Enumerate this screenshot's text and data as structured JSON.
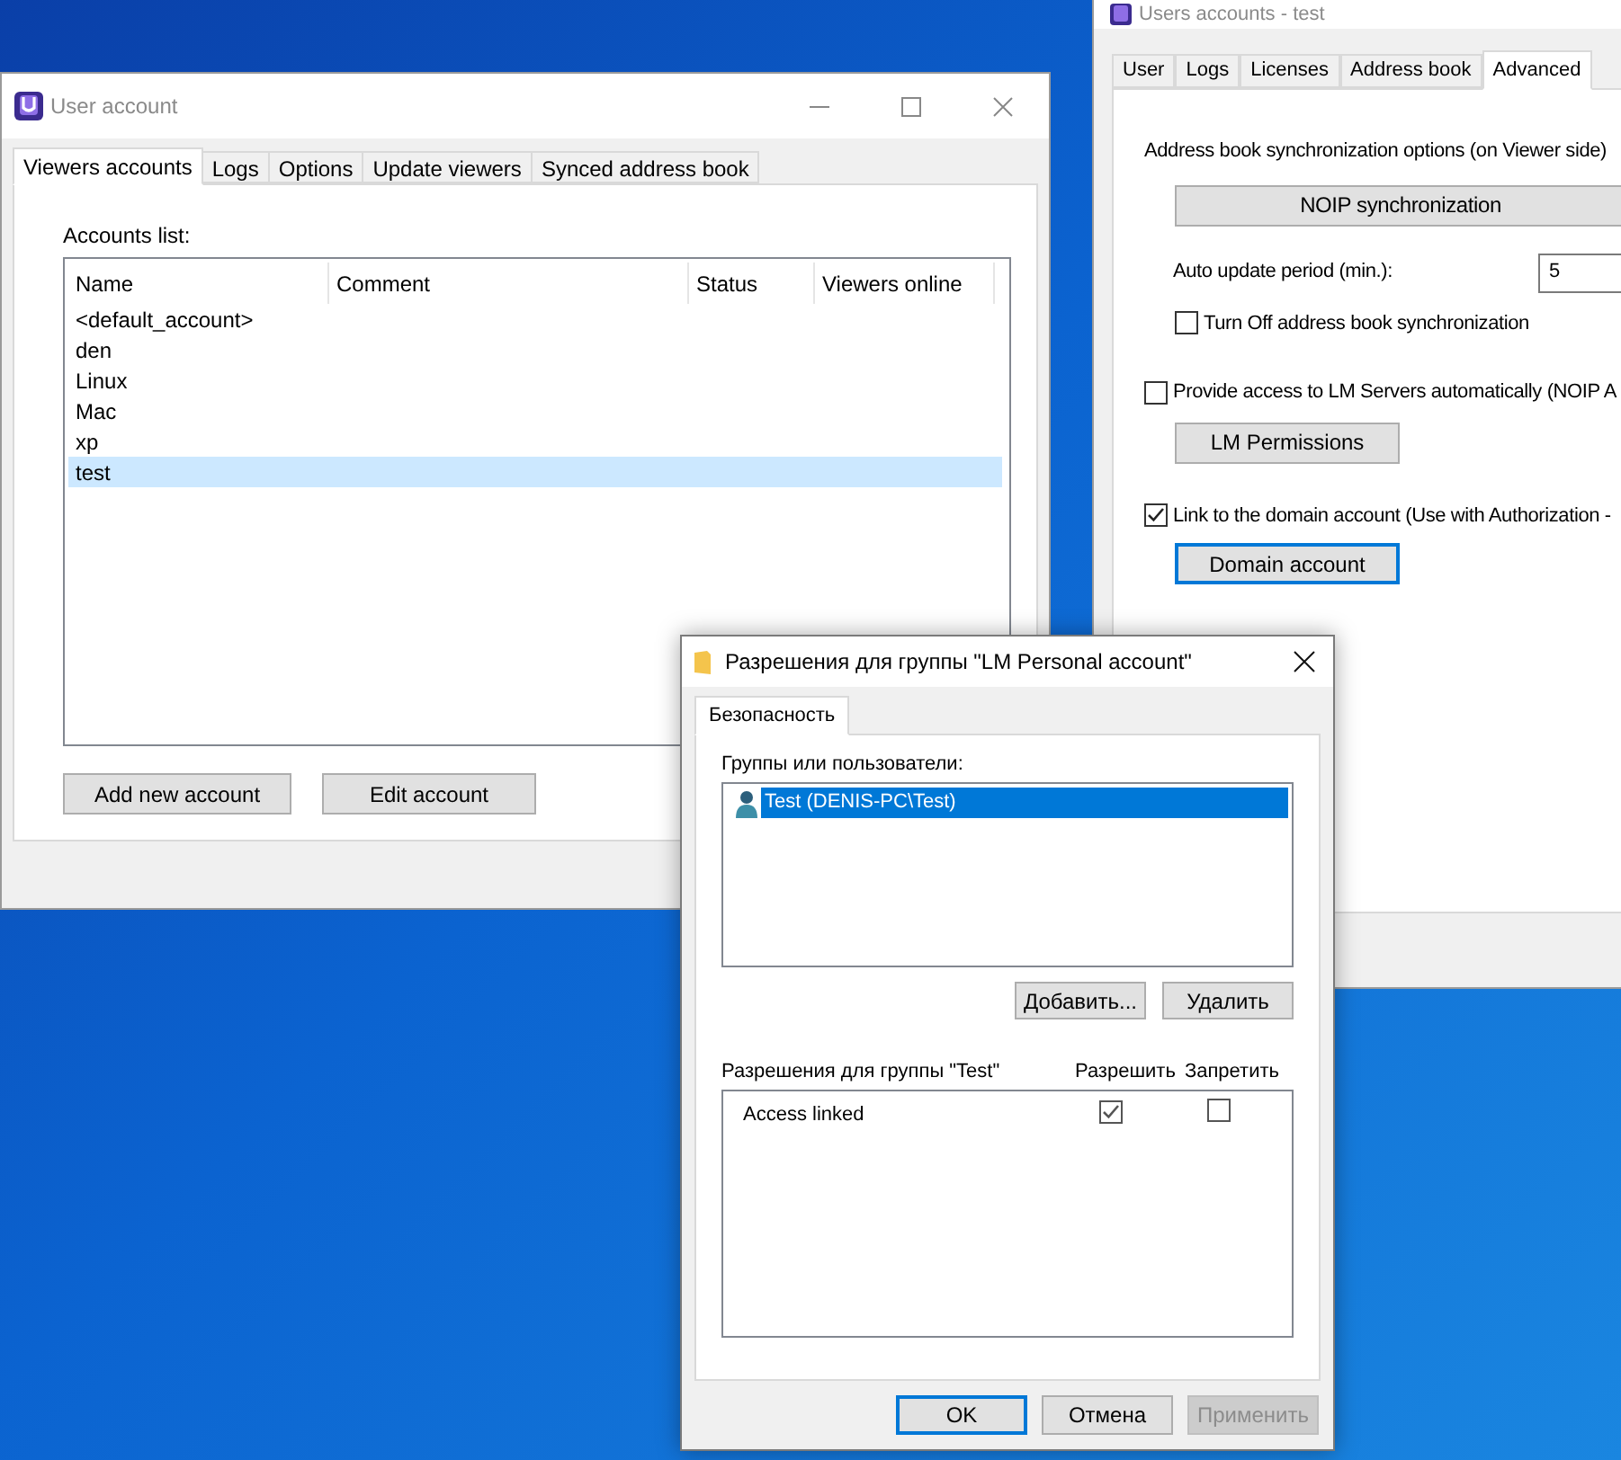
{
  "user_account_window": {
    "title": "User account",
    "tabs": [
      {
        "label": "Viewers accounts",
        "selected": true
      },
      {
        "label": "Logs",
        "selected": false
      },
      {
        "label": "Options",
        "selected": false
      },
      {
        "label": "Update viewers",
        "selected": false
      },
      {
        "label": "Synced address book",
        "selected": false
      }
    ],
    "accounts_label": "Accounts list:",
    "columns": [
      "Name",
      "Comment",
      "Status",
      "Viewers online"
    ],
    "rows": [
      {
        "name": "<default_account>",
        "selected": false
      },
      {
        "name": "den",
        "selected": false
      },
      {
        "name": "Linux",
        "selected": false
      },
      {
        "name": "Mac",
        "selected": false
      },
      {
        "name": "xp",
        "selected": false
      },
      {
        "name": "test",
        "selected": true
      }
    ],
    "buttons": [
      "Add new account",
      "Edit account"
    ]
  },
  "users_accounts_window": {
    "title": "Users accounts - test",
    "tabs": [
      {
        "label": "User",
        "selected": false
      },
      {
        "label": "Logs",
        "selected": false
      },
      {
        "label": "Licenses",
        "selected": false
      },
      {
        "label": "Address book",
        "selected": false
      },
      {
        "label": "Advanced",
        "selected": true
      }
    ],
    "sync_label": "Address book synchronization options (on Viewer side)",
    "noip_button": "NOIP synchronization",
    "auto_update_label": "Auto update period (min.):",
    "auto_update_value": "5",
    "turn_off": {
      "label": "Turn Off address book synchronization",
      "checked": false
    },
    "provide_access": {
      "label": "Provide access to LM Servers automatically (NOIP A",
      "checked": false
    },
    "lm_permissions_button": "LM Permissions",
    "link_domain": {
      "label": "Link to the domain account (Use with Authorization -",
      "checked": true
    },
    "domain_button": "Domain account"
  },
  "permissions_dialog": {
    "title": "Разрешения для группы \"LM Personal account\"",
    "tabs": [
      {
        "label": "Безопасность",
        "selected": true
      }
    ],
    "groups_label": "Группы или пользователи:",
    "users": [
      {
        "name": "Test (DENIS-PC\\Test)",
        "selected": true
      }
    ],
    "add_button": "Добавить...",
    "remove_button": "Удалить",
    "permissions_label": "Разрешения для группы \"Test\"",
    "allow_header": "Разрешить",
    "deny_header": "Запретить",
    "permissions": [
      {
        "name": "Access linked",
        "allow": true,
        "deny": false
      }
    ],
    "buttons": [
      {
        "label": "OK",
        "focused": true,
        "disabled": false
      },
      {
        "label": "Отмена",
        "focused": false,
        "disabled": false
      },
      {
        "label": "Применить",
        "focused": false,
        "disabled": true
      }
    ]
  }
}
